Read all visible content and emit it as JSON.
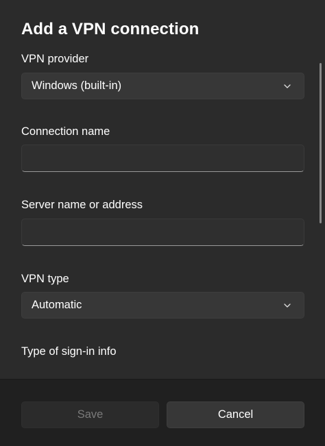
{
  "dialog": {
    "title": "Add a VPN connection"
  },
  "fields": {
    "vpn_provider": {
      "label": "VPN provider",
      "value": "Windows (built-in)",
      "icon": "chevron-down-icon"
    },
    "connection_name": {
      "label": "Connection name",
      "value": "",
      "placeholder": ""
    },
    "server_address": {
      "label": "Server name or address",
      "value": "",
      "placeholder": ""
    },
    "vpn_type": {
      "label": "VPN type",
      "value": "Automatic",
      "icon": "chevron-down-icon"
    },
    "sign_in_info": {
      "label": "Type of sign-in info"
    }
  },
  "footer": {
    "save_label": "Save",
    "save_enabled": false,
    "cancel_label": "Cancel"
  },
  "colors": {
    "dialog_bg": "#2b2b2b",
    "footer_bg": "#202020",
    "control_bg": "#373737",
    "disabled_text": "#7a7a7a"
  }
}
